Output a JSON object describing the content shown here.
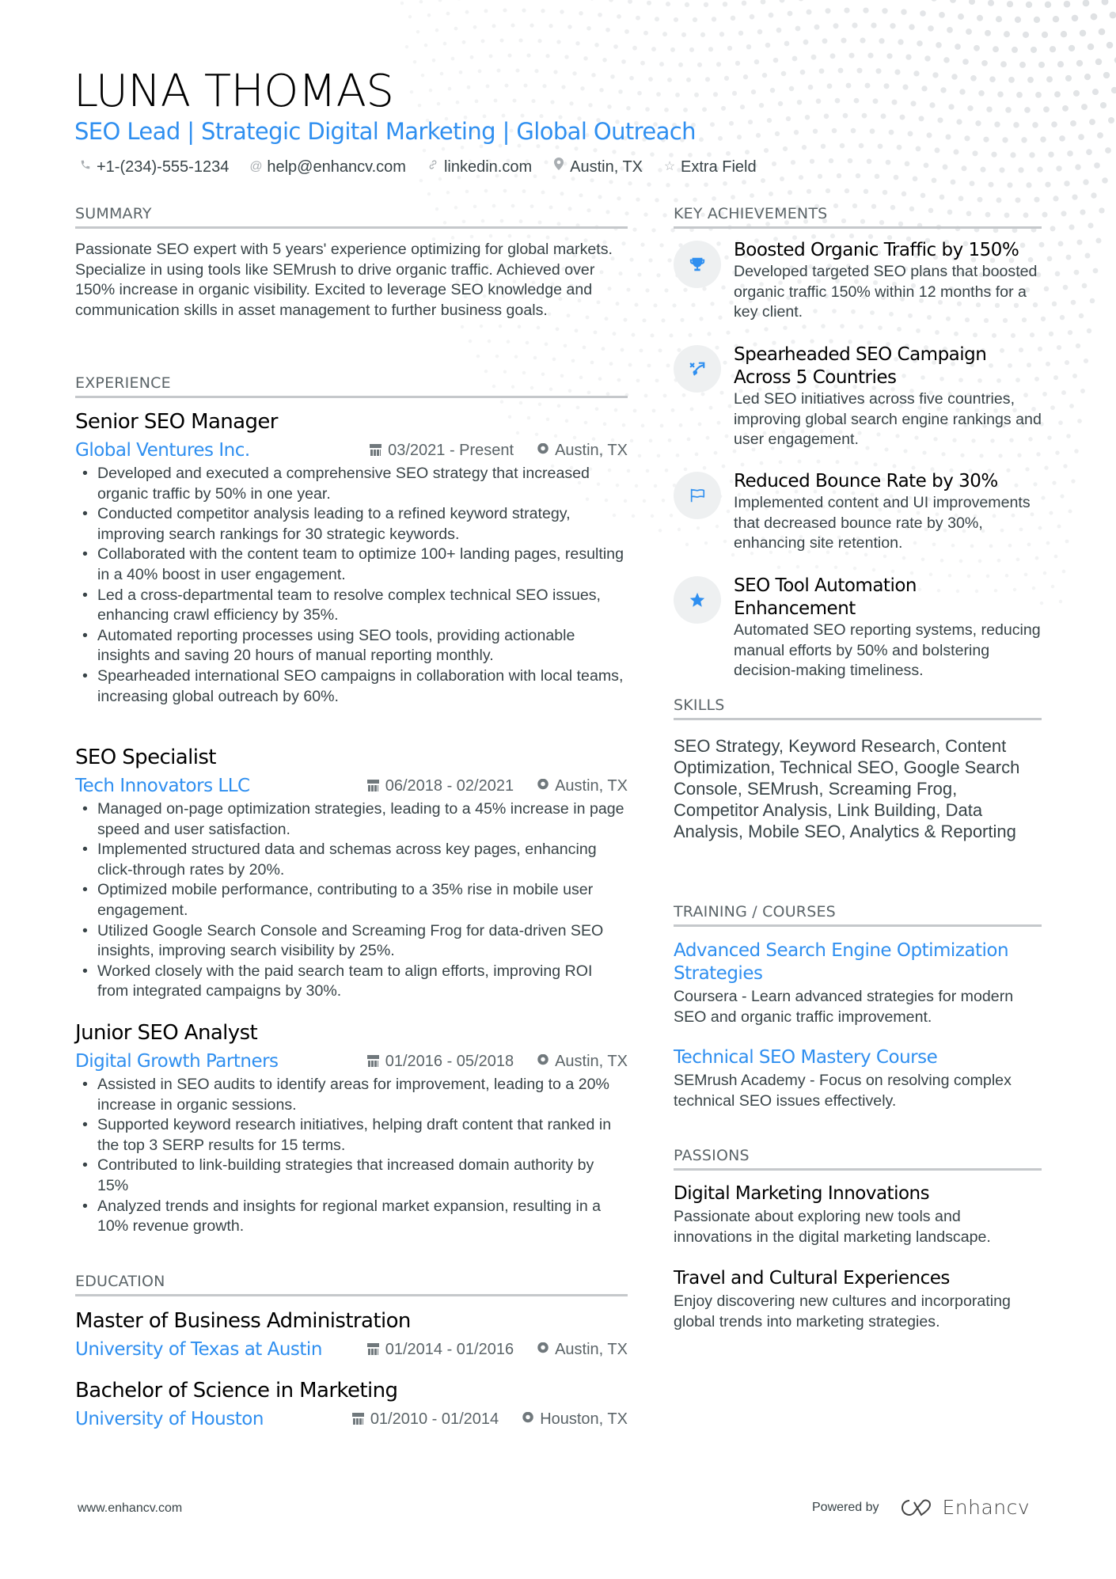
{
  "header": {
    "name": "LUNA THOMAS",
    "headline": "SEO Lead | Strategic Digital Marketing | Global Outreach",
    "contacts": [
      {
        "icon": "phone-icon",
        "text": "+1-(234)-555-1234"
      },
      {
        "icon": "at-icon",
        "text": "help@enhancv.com"
      },
      {
        "icon": "link-icon",
        "text": "linkedin.com"
      },
      {
        "icon": "location-pin-icon",
        "text": "Austin, TX"
      },
      {
        "icon": "star-outline-icon",
        "text": "Extra Field"
      }
    ]
  },
  "colors": {
    "accent": "#2f8ff0",
    "text": "#384347",
    "heading": "#5b6468",
    "rule": "#c5c8cb",
    "icon_circle": "#eef0f1"
  },
  "summary": {
    "heading": "SUMMARY",
    "text": "Passionate SEO expert with 5 years' experience optimizing for global markets. Specialize in using tools like SEMrush to drive organic traffic. Achieved over 150% increase in organic visibility. Excited to leverage SEO knowledge and communication skills in asset management to further business goals."
  },
  "experience": {
    "heading": "EXPERIENCE",
    "jobs": [
      {
        "title": "Senior SEO Manager",
        "company": "Global Ventures Inc.",
        "dates": "03/2021 - Present",
        "location": "Austin, TX",
        "bullets": [
          "Developed and executed a comprehensive SEO strategy that increased organic traffic by 50% in one year.",
          "Conducted competitor analysis leading to a refined keyword strategy, improving search rankings for 30 strategic keywords.",
          "Collaborated with the content team to optimize 100+ landing pages, resulting in a 40% boost in user engagement.",
          "Led a cross-departmental team to resolve complex technical SEO issues, enhancing crawl efficiency by 35%.",
          "Automated reporting processes using SEO tools, providing actionable insights and saving 20 hours of manual reporting monthly.",
          "Spearheaded international SEO campaigns in collaboration with local teams, increasing global outreach by 60%."
        ]
      },
      {
        "title": "SEO Specialist",
        "company": "Tech Innovators LLC",
        "dates": "06/2018 - 02/2021",
        "location": "Austin, TX",
        "bullets": [
          "Managed on-page optimization strategies, leading to a 45% increase in page speed and user satisfaction.",
          "Implemented structured data and schemas across key pages, enhancing click-through rates by 20%.",
          "Optimized mobile performance, contributing to a 35% rise in mobile user engagement.",
          "Utilized Google Search Console and Screaming Frog for data-driven SEO insights, improving search visibility by 25%.",
          "Worked closely with the paid search team to align efforts, improving ROI from integrated campaigns by 30%."
        ]
      },
      {
        "title": "Junior SEO Analyst",
        "company": "Digital Growth Partners",
        "dates": "01/2016 - 05/2018",
        "location": "Austin, TX",
        "bullets": [
          "Assisted in SEO audits to identify areas for improvement, leading to a 20% increase in organic sessions.",
          "Supported keyword research initiatives, helping draft content that ranked in the top 3 SERP results for 15 terms.",
          "Contributed to link-building strategies that increased domain authority by 15%",
          "Analyzed trends and insights for regional market expansion, resulting in a 10% revenue growth."
        ]
      }
    ]
  },
  "education": {
    "heading": "EDUCATION",
    "items": [
      {
        "degree": "Master of Business Administration",
        "school": "University of Texas at Austin",
        "dates": "01/2014 - 01/2016",
        "location": "Austin, TX"
      },
      {
        "degree": "Bachelor of Science in Marketing",
        "school": "University of Houston",
        "dates": "01/2010 - 01/2014",
        "location": "Houston, TX"
      }
    ]
  },
  "achievements": {
    "heading": "KEY ACHIEVEMENTS",
    "items": [
      {
        "icon": "trophy-icon",
        "title": "Boosted Organic Traffic by 150%",
        "desc": "Developed targeted SEO plans that boosted organic traffic 150% within 12 months for a key client."
      },
      {
        "icon": "strategy-icon",
        "title": "Spearheaded SEO Campaign Across 5 Countries",
        "desc": "Led SEO initiatives across five countries, improving global search engine rankings and user engagement."
      },
      {
        "icon": "flag-icon",
        "title": "Reduced Bounce Rate by 30%",
        "desc": "Implemented content and UI improvements that decreased bounce rate by 30%, enhancing site retention."
      },
      {
        "icon": "star-icon",
        "title": "SEO Tool Automation Enhancement",
        "desc": "Automated SEO reporting systems, reducing manual efforts by 50% and bolstering decision-making timeliness."
      }
    ]
  },
  "skills": {
    "heading": "SKILLS",
    "text": "SEO Strategy, Keyword Research, Content Optimization, Technical SEO, Google Search Console, SEMrush, Screaming Frog, Competitor Analysis, Link Building, Data Analysis, Mobile SEO, Analytics & Reporting"
  },
  "training": {
    "heading": "TRAINING / COURSES",
    "items": [
      {
        "title": "Advanced Search Engine Optimization Strategies",
        "desc": "Coursera - Learn advanced strategies for modern SEO and organic traffic improvement."
      },
      {
        "title": "Technical SEO Mastery Course",
        "desc": "SEMrush Academy - Focus on resolving complex technical SEO issues effectively."
      }
    ]
  },
  "passions": {
    "heading": "PASSIONS",
    "items": [
      {
        "title": "Digital Marketing Innovations",
        "desc": "Passionate about exploring new tools and innovations in the digital marketing landscape."
      },
      {
        "title": "Travel and Cultural Experiences",
        "desc": "Enjoy discovering new cultures and incorporating global trends into marketing strategies."
      }
    ]
  },
  "footer": {
    "website": "www.enhancv.com",
    "powered_by": "Powered by",
    "brand": "Enhancv"
  }
}
